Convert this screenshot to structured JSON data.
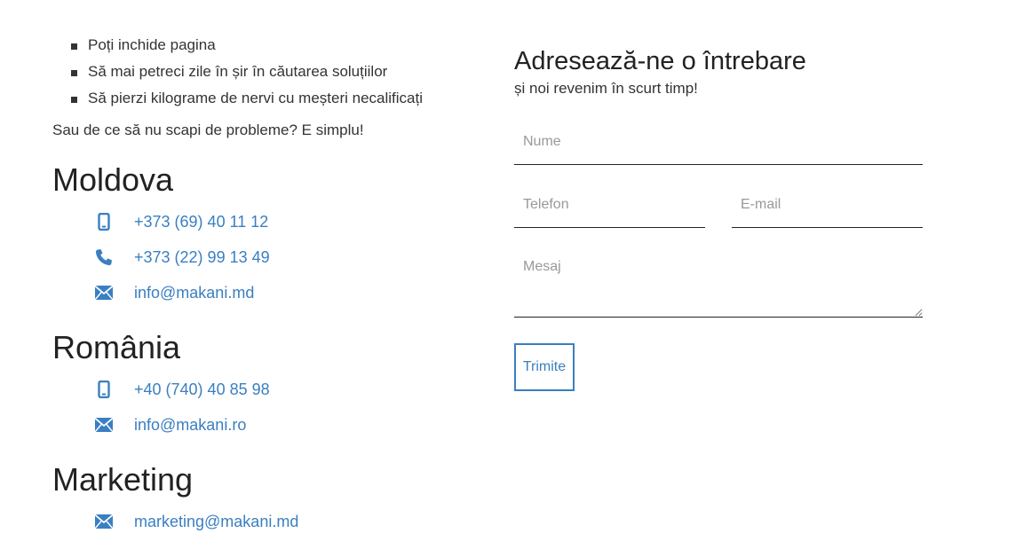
{
  "bullets": [
    "Poți inchide pagina",
    "Să mai petreci zile în șir în căutarea soluțiilor",
    "Să pierzi kilograme de nervi cu meșteri necalificați"
  ],
  "intro": "Sau de ce să nu scapi de probleme? E simplu!",
  "moldova": {
    "title": "Moldova",
    "mobile": "+373 (69) 40 11 12",
    "phone": "+373 (22) 99 13 49",
    "email": "info@makani.md"
  },
  "romania": {
    "title": "România",
    "mobile": "+40 (740) 40 85 98",
    "email": "info@makani.ro"
  },
  "marketing": {
    "title": "Marketing",
    "email": "marketing@makani.md"
  },
  "form": {
    "title": "Adresează-ne o întrebare",
    "subtitle": "și noi revenim în scurt timp!",
    "name_placeholder": "Nume",
    "phone_placeholder": "Telefon",
    "email_placeholder": "E-mail",
    "message_placeholder": "Mesaj",
    "submit_label": "Trimite"
  },
  "colors": {
    "accent": "#3a7fc1",
    "text": "#333333",
    "heading": "#222222"
  },
  "icons": {
    "mobile": "mobile-phone-icon",
    "phone": "phone-handset-icon",
    "email": "envelope-icon"
  }
}
